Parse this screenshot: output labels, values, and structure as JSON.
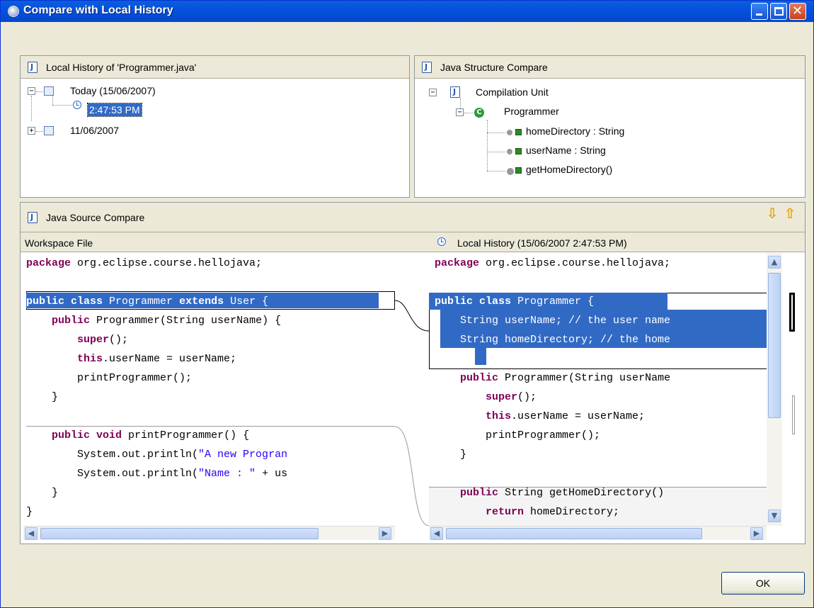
{
  "window": {
    "title": "Compare with Local History"
  },
  "history_panel": {
    "title": "Local History of 'Programmer.java'",
    "items": [
      {
        "label": "Today (15/06/2007)",
        "expanded": true
      },
      {
        "label": "2:47:53 PM",
        "selected": true
      },
      {
        "label": "11/06/2007",
        "expanded": false
      }
    ]
  },
  "structure_panel": {
    "title": "Java Structure Compare",
    "root": "Compilation Unit",
    "class_name": "Programmer",
    "members": [
      "homeDirectory : String",
      "userName : String",
      "getHomeDirectory()"
    ]
  },
  "source_panel": {
    "title": "Java Source Compare",
    "left_header": "Workspace File",
    "right_header": "Local History (15/06/2007 2:47:53 PM)",
    "left_lines": [
      [
        [
          "t",
          "package"
        ],
        [
          "p",
          " org.eclipse.course.hellojava;"
        ]
      ],
      [],
      [
        [
          "t",
          "public class"
        ],
        [
          "p",
          " Programmer "
        ],
        [
          "t",
          "extends"
        ],
        [
          "p",
          " User {"
        ]
      ],
      [
        [
          "p",
          "    "
        ],
        [
          "t",
          "public"
        ],
        [
          "p",
          " Programmer(String userName) {"
        ]
      ],
      [
        [
          "p",
          "        "
        ],
        [
          "t",
          "super"
        ],
        [
          "p",
          "();"
        ]
      ],
      [
        [
          "p",
          "        "
        ],
        [
          "t",
          "this"
        ],
        [
          "p",
          ".userName = userName;"
        ]
      ],
      [
        [
          "p",
          "        printProgrammer();"
        ]
      ],
      [
        [
          "p",
          "    }"
        ]
      ],
      [],
      [
        [
          "p",
          "    "
        ],
        [
          "t",
          "public void"
        ],
        [
          "p",
          " printProgrammer() {"
        ]
      ],
      [
        [
          "p",
          "        System.out.println("
        ],
        [
          "s",
          "\"A new Progran"
        ]
      ],
      [
        [
          "p",
          "        System.out.println("
        ],
        [
          "s",
          "\"Name : \""
        ],
        [
          "p",
          " + us"
        ]
      ],
      [
        [
          "p",
          "    }"
        ]
      ],
      [
        [
          "p",
          "}"
        ]
      ]
    ],
    "right_lines": [
      [
        [
          "t",
          "package"
        ],
        [
          "p",
          " org.eclipse.course.hellojava;"
        ]
      ],
      [],
      [
        [
          "t",
          "public class"
        ],
        [
          "p",
          " Programmer {"
        ]
      ],
      [
        [
          "p",
          "    String userName; // the user name"
        ]
      ],
      [
        [
          "p",
          "    String homeDirectory; // the home"
        ]
      ],
      [],
      [
        [
          "p",
          "    "
        ],
        [
          "t",
          "public"
        ],
        [
          "p",
          " Programmer(String userName"
        ]
      ],
      [
        [
          "p",
          "        "
        ],
        [
          "t",
          "super"
        ],
        [
          "p",
          "();"
        ]
      ],
      [
        [
          "p",
          "        "
        ],
        [
          "t",
          "this"
        ],
        [
          "p",
          ".userName = userName;"
        ]
      ],
      [
        [
          "p",
          "        printProgrammer();"
        ]
      ],
      [
        [
          "p",
          "    }"
        ]
      ],
      [],
      [
        [
          "p",
          "    "
        ],
        [
          "t",
          "public"
        ],
        [
          "p",
          " String getHomeDirectory()"
        ]
      ],
      [
        [
          "p",
          "        "
        ],
        [
          "t",
          "return"
        ],
        [
          "p",
          " homeDirectory;"
        ]
      ]
    ]
  },
  "buttons": {
    "ok": "OK"
  }
}
